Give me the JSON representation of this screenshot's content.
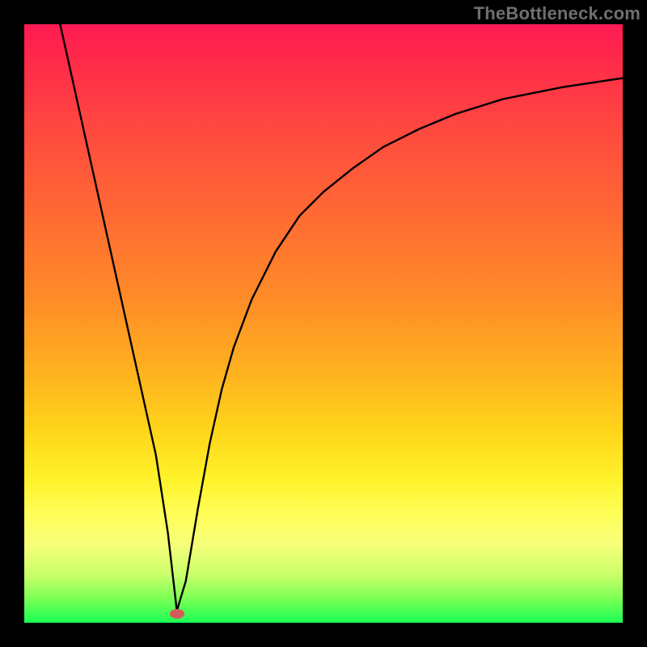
{
  "watermark": "TheBottleneck.com",
  "chart_data": {
    "type": "line",
    "title": "",
    "xlabel": "",
    "ylabel": "",
    "xlim": [
      0,
      100
    ],
    "ylim": [
      0,
      100
    ],
    "grid": false,
    "legend": false,
    "notes": "Chart has no visible axes, tick labels, or data labels; values are estimated from pixel positions. X and Y are on 0–100 scales mapped to the 740×740 plot area. Y=0 is bottom, Y=100 is top. Background encodes Y via color gradient (green≈0 → red≈100).",
    "series": [
      {
        "name": "curve",
        "x": [
          6,
          8,
          10,
          12,
          14,
          16,
          18,
          20,
          22,
          24,
          25.5,
          27,
          29,
          31,
          33,
          35,
          38,
          42,
          46,
          50,
          55,
          60,
          66,
          72,
          80,
          90,
          100
        ],
        "y": [
          100,
          91,
          82,
          73,
          64,
          55,
          46,
          37,
          28,
          15,
          2,
          7,
          19,
          30,
          39,
          46,
          54,
          62,
          68,
          72,
          76,
          79.5,
          82.5,
          85,
          87.5,
          89.5,
          91
        ]
      }
    ],
    "marker": {
      "x": 25.5,
      "y": 1.5,
      "color": "#d65a5a"
    }
  }
}
